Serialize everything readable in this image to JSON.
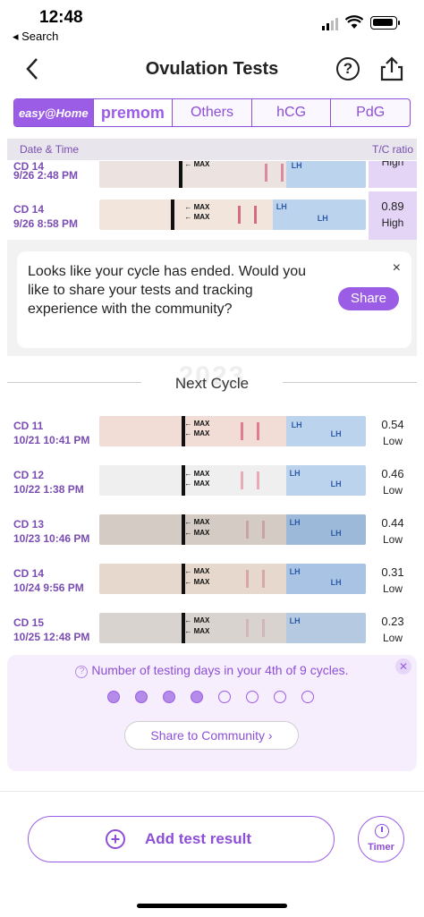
{
  "status": {
    "time": "12:48",
    "back": "◂ Search"
  },
  "nav": {
    "title": "Ovulation Tests",
    "help": "?"
  },
  "brands": [
    "easy@Home",
    "premom",
    "Others",
    "hCG",
    "PdG"
  ],
  "table": {
    "col_date": "Date & Time",
    "col_ratio": "T/C ratio"
  },
  "rows_prev": [
    {
      "cd": "CD 14",
      "date": "9/26 2:48 PM",
      "ratio": "",
      "level": "High"
    },
    {
      "cd": "CD 14",
      "date": "9/26 8:58 PM",
      "ratio": "0.89",
      "level": "High"
    }
  ],
  "popup": {
    "text": "Looks like your cycle has ended. Would you like to share your tests and tracking experience with the community?",
    "share": "Share",
    "close": "×"
  },
  "next_cycle": {
    "year": "2023",
    "label": "Next Cycle"
  },
  "rows": [
    {
      "cd": "CD 11",
      "date": "10/21 10:41 PM",
      "ratio": "0.54",
      "level": "Low"
    },
    {
      "cd": "CD 12",
      "date": "10/22 1:38 PM",
      "ratio": "0.46",
      "level": "Low"
    },
    {
      "cd": "CD 13",
      "date": "10/23 10:46 PM",
      "ratio": "0.44",
      "level": "Low"
    },
    {
      "cd": "CD 14",
      "date": "10/24 9:56 PM",
      "ratio": "0.31",
      "level": "Low"
    },
    {
      "cd": "CD 15",
      "date": "10/25 12:48 PM",
      "ratio": "0.23",
      "level": "Low"
    }
  ],
  "strip_text": {
    "max": "MAX",
    "lh": "LH"
  },
  "promo": {
    "text": "Number of testing days in your 4th of 9 cycles.",
    "button": "Share to Community",
    "dots_filled": 4,
    "dots_total": 8
  },
  "add_button": "Add test result",
  "timer": "Timer",
  "colors": {
    "accent": "#9b5de5",
    "highlight": "#e4d4f6"
  }
}
